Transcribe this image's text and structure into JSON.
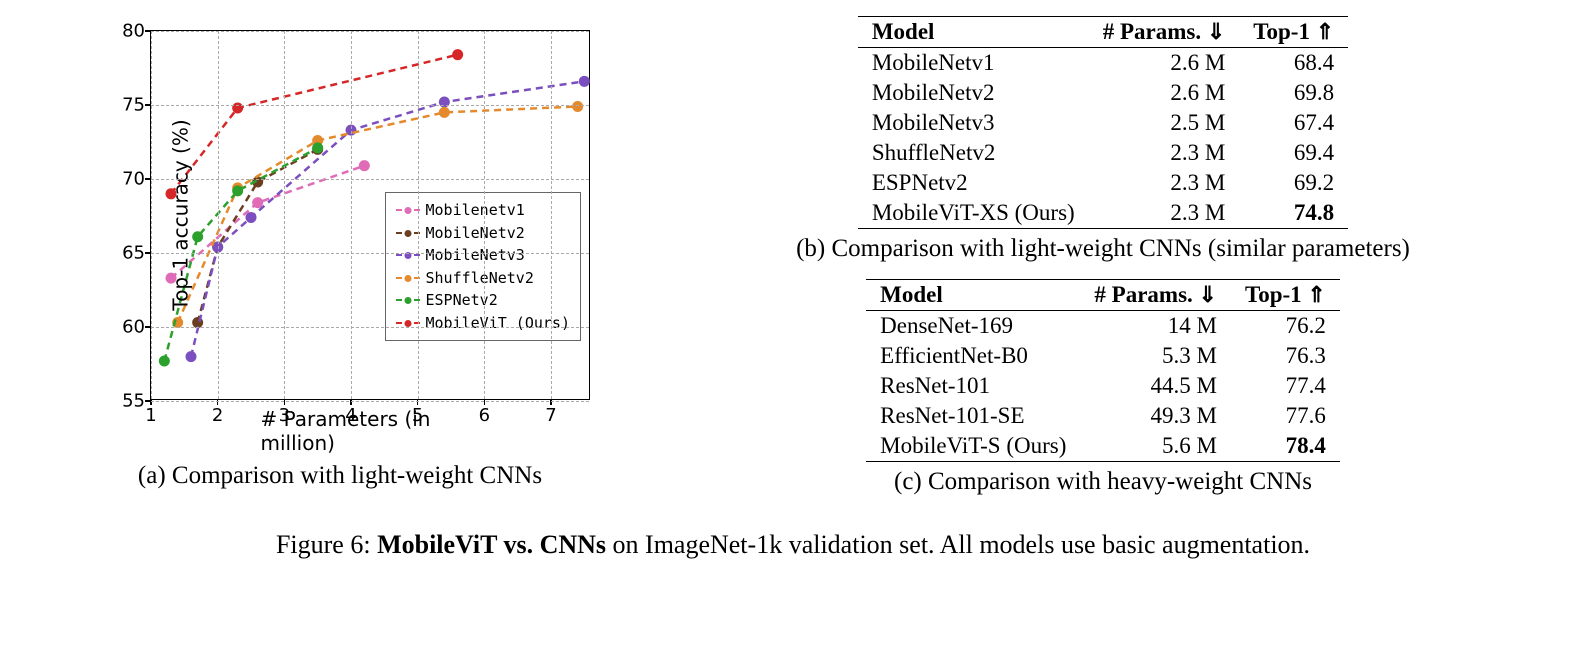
{
  "chart_data": {
    "type": "line",
    "xlabel": "# Parameters (in million)",
    "ylabel": "Top-1 accuracy (%)",
    "xlim": [
      1,
      7.6
    ],
    "ylim": [
      55,
      80
    ],
    "xticks": [
      1,
      2,
      3,
      4,
      5,
      6,
      7
    ],
    "yticks": [
      55,
      60,
      65,
      70,
      75,
      80
    ],
    "series": [
      {
        "name": "Mobilenetv1",
        "color": "#e06bb6",
        "x": [
          1.3,
          2.6,
          4.2
        ],
        "y": [
          63.3,
          68.4,
          70.9
        ]
      },
      {
        "name": "MobileNetv2",
        "color": "#6b3e1f",
        "x": [
          1.7,
          2.0,
          2.6,
          3.5
        ],
        "y": [
          60.3,
          65.4,
          69.8,
          72.0
        ]
      },
      {
        "name": "MobileNetv3",
        "color": "#7b4fbf",
        "x": [
          1.6,
          2.0,
          2.5,
          4.0,
          5.4,
          7.5
        ],
        "y": [
          58.0,
          65.4,
          67.4,
          73.3,
          75.2,
          76.6
        ]
      },
      {
        "name": "ShuffleNetv2",
        "color": "#e58a2c",
        "x": [
          1.4,
          2.3,
          3.5,
          5.4,
          7.4
        ],
        "y": [
          60.3,
          69.4,
          72.6,
          74.5,
          74.9
        ]
      },
      {
        "name": "ESPNetv2",
        "color": "#2ca02c",
        "x": [
          1.2,
          1.7,
          2.3,
          3.5
        ],
        "y": [
          57.7,
          66.1,
          69.2,
          72.1
        ]
      },
      {
        "name": "MobileViT (Ours)",
        "color": "#d62728",
        "x": [
          1.3,
          2.3,
          5.6
        ],
        "y": [
          69.0,
          74.8,
          78.4
        ]
      }
    ]
  },
  "subcaption_a": "(a) Comparison with light-weight CNNs",
  "subcaption_b": "(b) Comparison with light-weight CNNs (similar parameters)",
  "subcaption_c": "(c) Comparison with heavy-weight CNNs",
  "main_caption_prefix": "Figure 6: ",
  "main_caption_bold": "MobileViT vs. CNNs",
  "main_caption_suffix": " on ImageNet-1k validation set. All models use basic augmentation.",
  "table_header": {
    "model": "Model",
    "params": "# Params.",
    "top1": "Top-1"
  },
  "table_b": [
    {
      "model": "MobileNetv1",
      "params": "2.6 M",
      "top1": "68.4",
      "bold": false
    },
    {
      "model": "MobileNetv2",
      "params": "2.6 M",
      "top1": "69.8",
      "bold": false
    },
    {
      "model": "MobileNetv3",
      "params": "2.5 M",
      "top1": "67.4",
      "bold": false
    },
    {
      "model": "ShuffleNetv2",
      "params": "2.3 M",
      "top1": "69.4",
      "bold": false
    },
    {
      "model": "ESPNetv2",
      "params": "2.3 M",
      "top1": "69.2",
      "bold": false
    },
    {
      "model": "MobileViT-XS (Ours)",
      "params": "2.3 M",
      "top1": "74.8",
      "bold": true
    }
  ],
  "table_c": [
    {
      "model": "DenseNet-169",
      "params": "14 M",
      "top1": "76.2",
      "bold": false
    },
    {
      "model": "EfficientNet-B0",
      "params": "5.3 M",
      "top1": "76.3",
      "bold": false
    },
    {
      "model": "ResNet-101",
      "params": "44.5 M",
      "top1": "77.4",
      "bold": false
    },
    {
      "model": "ResNet-101-SE",
      "params": "49.3 M",
      "top1": "77.6",
      "bold": false
    },
    {
      "model": "MobileViT-S (Ours)",
      "params": "5.6 M",
      "top1": "78.4",
      "bold": true
    }
  ]
}
